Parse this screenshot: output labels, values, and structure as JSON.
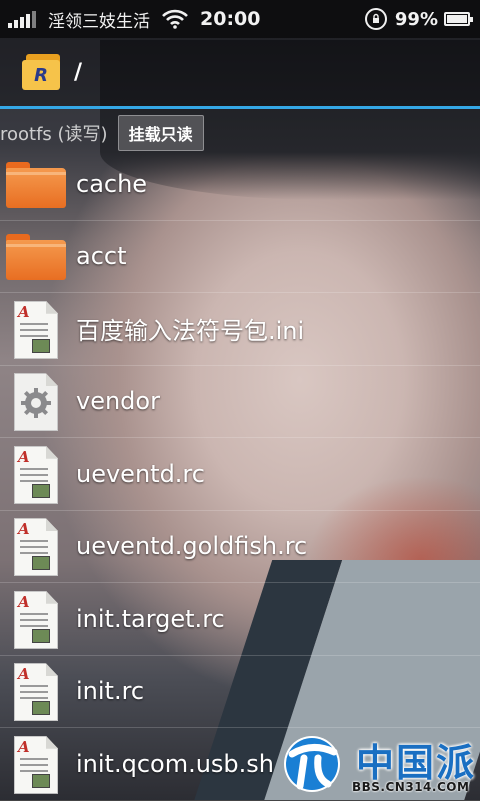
{
  "status_bar": {
    "carrier": "淫领三妓生活",
    "time": "20:00",
    "battery_percent": "99%",
    "battery_level": 0.99,
    "rotation_lock_icon": "rotation-lock-icon",
    "wifi_icon": "wifi-icon",
    "signal_icon": "signal-bars-icon"
  },
  "header": {
    "app_icon": "root-explorer-folder-icon",
    "app_icon_letter": "R",
    "path": "/"
  },
  "mount": {
    "label": "rootfs (读写)",
    "button_label": "挂载只读"
  },
  "files": [
    {
      "name": "cache",
      "icon": "folder-icon",
      "type": "folder"
    },
    {
      "name": "acct",
      "icon": "folder-icon",
      "type": "folder"
    },
    {
      "name": "百度输入法符号包.ini",
      "icon": "document-icon",
      "type": "doc"
    },
    {
      "name": "vendor",
      "icon": "gear-icon",
      "type": "gear"
    },
    {
      "name": "ueventd.rc",
      "icon": "document-icon",
      "type": "doc"
    },
    {
      "name": "ueventd.goldfish.rc",
      "icon": "document-icon",
      "type": "doc"
    },
    {
      "name": "init.target.rc",
      "icon": "document-icon",
      "type": "doc"
    },
    {
      "name": "init.rc",
      "icon": "document-icon",
      "type": "doc"
    },
    {
      "name": "init.qcom.usb.sh",
      "icon": "document-icon",
      "type": "doc"
    }
  ],
  "watermark": {
    "brand": "中国派",
    "url": "BBS.CN314.COM"
  },
  "colors": {
    "accent_line": "#35a8e6",
    "folder": "#e86e22",
    "watermark_blue": "#1a6fc2"
  }
}
